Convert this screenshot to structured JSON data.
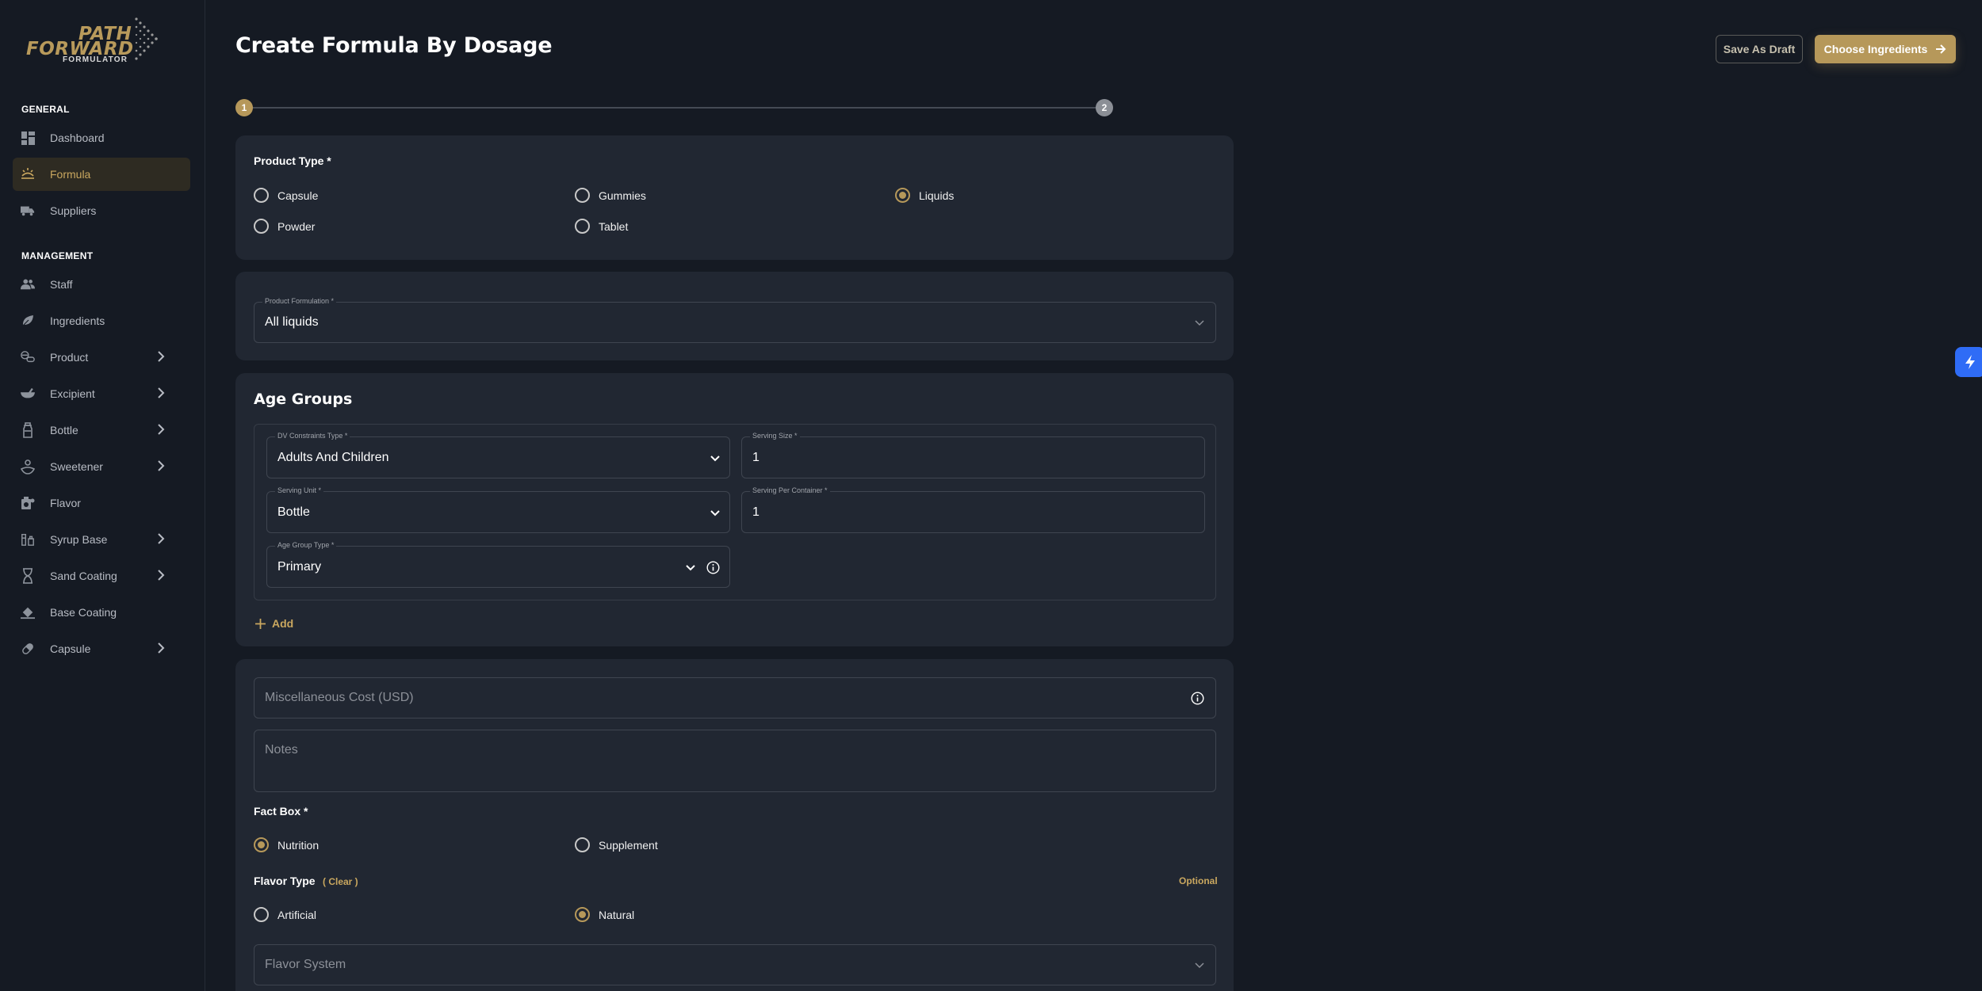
{
  "brand": {
    "line1": "PATH",
    "line2": "FORWARD",
    "line3": "FORMULATOR"
  },
  "sidebar": {
    "general_label": "GENERAL",
    "management_label": "MANAGEMENT",
    "items": [
      {
        "label": "Dashboard",
        "icon": "dashboard-icon"
      },
      {
        "label": "Formula",
        "icon": "formula-icon",
        "active": true
      },
      {
        "label": "Suppliers",
        "icon": "truck-icon"
      },
      {
        "label": "Staff",
        "icon": "people-icon"
      },
      {
        "label": "Ingredients",
        "icon": "leaf-icon"
      },
      {
        "label": "Product",
        "icon": "pills-icon",
        "expandable": true
      },
      {
        "label": "Excipient",
        "icon": "mortar-icon",
        "expandable": true
      },
      {
        "label": "Bottle",
        "icon": "bottle-icon",
        "expandable": true
      },
      {
        "label": "Sweetener",
        "icon": "sweetener-icon",
        "expandable": true
      },
      {
        "label": "Flavor",
        "icon": "flavor-icon"
      },
      {
        "label": "Syrup Base",
        "icon": "syrup-icon",
        "expandable": true
      },
      {
        "label": "Sand Coating",
        "icon": "hourglass-icon",
        "expandable": true
      },
      {
        "label": "Base Coating",
        "icon": "coating-icon"
      },
      {
        "label": "Capsule",
        "icon": "capsule-icon",
        "expandable": true
      }
    ]
  },
  "header": {
    "title": "Create Formula By Dosage",
    "save_draft": "Save As Draft",
    "choose_ingredients": "Choose Ingredients"
  },
  "stepper": {
    "step1": "1",
    "step2": "2",
    "current": 1
  },
  "product_type": {
    "label": "Product Type *",
    "options": [
      "Capsule",
      "Gummies",
      "Liquids",
      "Powder",
      "Tablet"
    ],
    "selected": "Liquids"
  },
  "product_formulation": {
    "label": "Product Formulation *",
    "value": "All liquids"
  },
  "age_groups": {
    "title": "Age Groups",
    "dv_constraints": {
      "label": "DV Constraints Type *",
      "value": "Adults And Children"
    },
    "serving_size": {
      "label": "Serving Size *",
      "value": "1"
    },
    "serving_unit": {
      "label": "Serving Unit *",
      "value": "Bottle"
    },
    "serving_per_container": {
      "label": "Serving Per Container *",
      "value": "1"
    },
    "age_group_type": {
      "label": "Age Group Type *",
      "value": "Primary"
    },
    "add_label": "Add"
  },
  "misc": {
    "misc_cost_placeholder": "Miscellaneous Cost (USD)",
    "notes_placeholder": "Notes",
    "fact_box_label": "Fact Box *",
    "fact_box_options": [
      "Nutrition",
      "Supplement"
    ],
    "fact_box_selected": "Nutrition",
    "flavor_type_label": "Flavor Type",
    "clear_label": "( Clear )",
    "optional_label": "Optional",
    "flavor_type_options": [
      "Artificial",
      "Natural"
    ],
    "flavor_type_selected": "Natural",
    "flavor_system_placeholder": "Flavor System"
  },
  "colors": {
    "accent": "#b6985a",
    "background": "#151a23",
    "card": "#212732",
    "float_button": "#2f6cf6"
  }
}
